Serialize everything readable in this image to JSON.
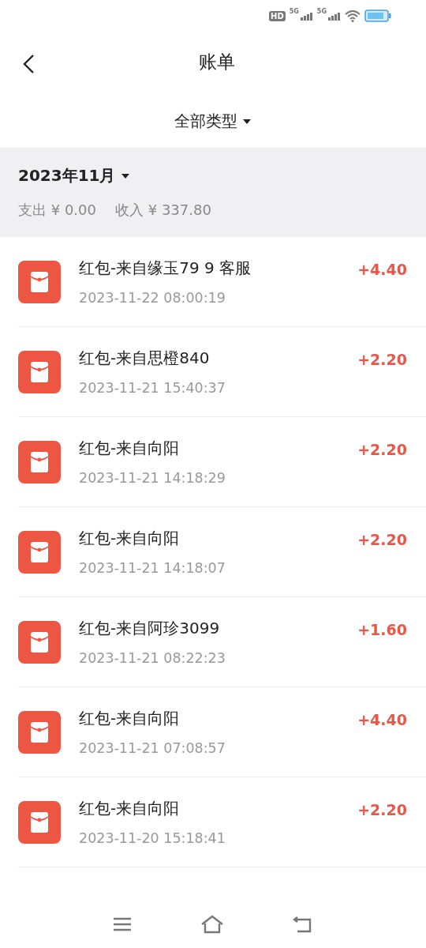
{
  "status_bar": {
    "network_labels": [
      "HD",
      "5G",
      "5G"
    ]
  },
  "header": {
    "title": "账单"
  },
  "filter": {
    "label": "全部类型"
  },
  "month": {
    "label": "2023年11月",
    "expense": "支出 ¥ 0.00",
    "income": "收入 ¥ 337.80"
  },
  "transactions": [
    {
      "title": "红包-来自缘玉79 9 客服",
      "time": "2023-11-22 08:00:19",
      "amount": "+4.40"
    },
    {
      "title": "红包-来自思橙840",
      "time": "2023-11-21 15:40:37",
      "amount": "+2.20"
    },
    {
      "title": "红包-来自向阳",
      "time": "2023-11-21 14:18:29",
      "amount": "+2.20"
    },
    {
      "title": "红包-来自向阳",
      "time": "2023-11-21 14:18:07",
      "amount": "+2.20"
    },
    {
      "title": "红包-来自阿珍3099",
      "time": "2023-11-21 08:22:23",
      "amount": "+1.60"
    },
    {
      "title": "红包-来自向阳",
      "time": "2023-11-21 07:08:57",
      "amount": "+4.40"
    },
    {
      "title": "红包-来自向阳",
      "time": "2023-11-20 15:18:41",
      "amount": "+2.20"
    }
  ]
}
